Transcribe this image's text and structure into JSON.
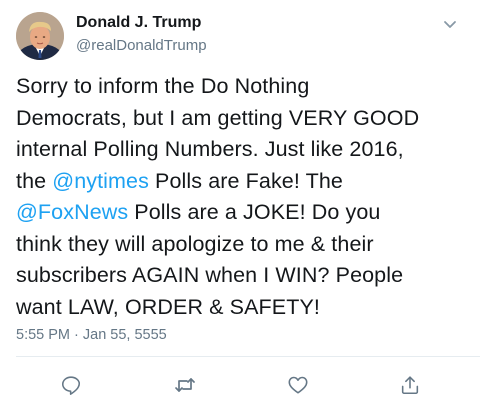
{
  "author": {
    "display_name": "Donald J. Trump",
    "handle": "@realDonaldTrump"
  },
  "tweet": {
    "line1": "Sorry to inform the Do Nothing",
    "line2": "Democrats, but I am getting VERY GOOD",
    "line3": "internal Polling Numbers. Just like 2016,",
    "line4_pre": "the ",
    "mention1": "@nytimes",
    "line4_post": " Polls are Fake! The",
    "mention2": "@FoxNews",
    "line5_post": " Polls are a JOKE! Do you",
    "line6": "think they will apologize to me & their",
    "line7": "subscribers AGAIN when I WIN? People",
    "line8": "want LAW, ORDER & SAFETY!",
    "timestamp": "5:55 PM · Jan 55, 5555"
  },
  "icons": {
    "menu": "chevron-down-icon",
    "reply": "reply-icon",
    "retweet": "retweet-icon",
    "like": "heart-icon",
    "share": "share-icon"
  },
  "colors": {
    "text": "#14171a",
    "secondary": "#657786",
    "link": "#1da1f2",
    "divider": "#e6ecf0"
  }
}
